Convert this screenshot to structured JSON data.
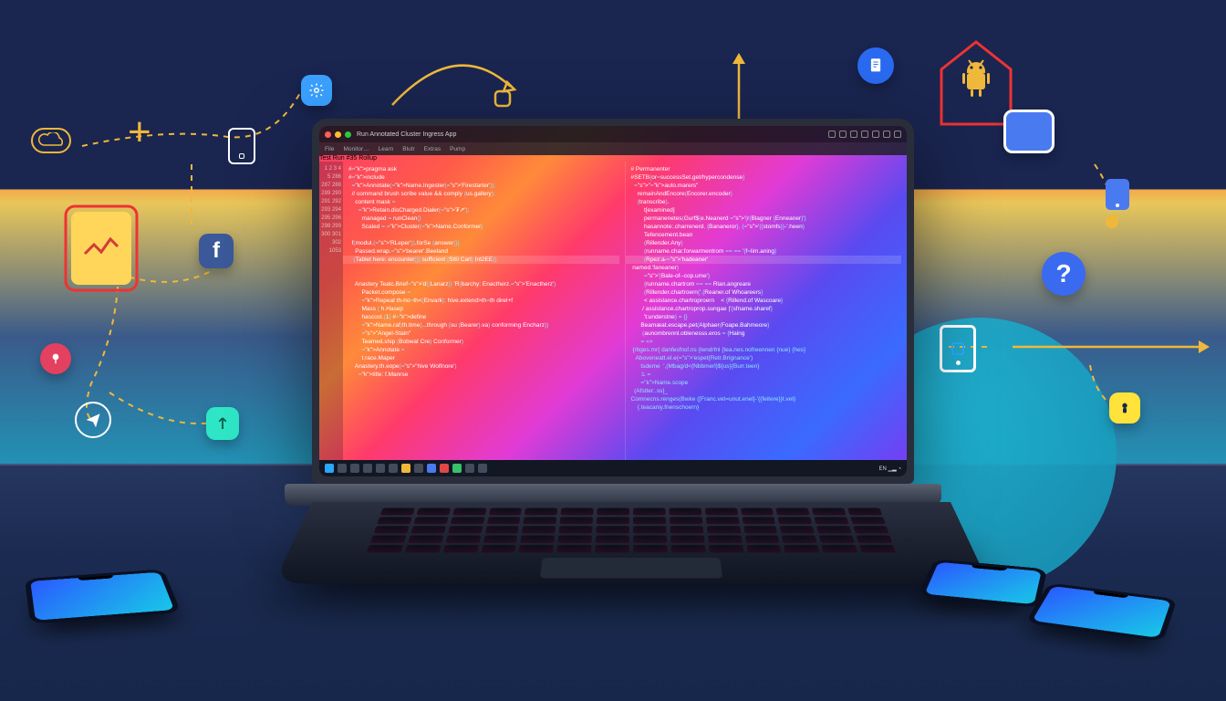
{
  "scene": {
    "description": "Stylized marketing illustration: an open laptop showing a colorful code editor on a desk, surrounded by three smartphones and floating app/platform icons connected with dotted lines.",
    "background_colors": [
      "#1a2550",
      "#f5a84a",
      "#1ba3c2",
      "#224070"
    ]
  },
  "laptop": {
    "window_title": "Run Annotated Cluster Ingress App",
    "menu": [
      "File",
      "Monitor…",
      "Learn",
      "Blutr",
      "Extras",
      "Pump"
    ],
    "tab_pill": "Test Run  #35 Rollup",
    "line_numbers": [
      "1",
      "2",
      "3",
      "4",
      "5",
      "286",
      "287",
      "288",
      "289",
      "290",
      "291",
      "292",
      "293",
      "294",
      "295",
      "296",
      "298",
      "299",
      "300",
      "301",
      "302",
      "1053"
    ],
    "code_left": [
      "#pragma ask",
      "#include <device>",
      "  Annotate(Name.Ingester('Firestarter'));",
      "  // command brush scribe value && comply (us.gallery);",
      "    content mask =",
      "      Retain.disCharged.Dialer('₮↗');",
      "        managed = runClean()",
      "        Scaled = Cluster(Name.Conformer)",
      "",
      "  f(modul.('RLeper')).forSe (answer())",
      "    Passed.wrap.'bearer'.Beeland",
      "   (Tablet here: encounter()) sufficient (Sttil Carl) Int2EE()",
      "",
      "    Anastery Teatc.Brief'd((Lanarz)) 'R{barchy: Enactherz.'Enactherz')",
      "        Packet.compose =",
      "        Repeat th-ho=th<{Envark}; hive.extend>th=th direl+f",
      "        Mass ( h.Hasep",
      "        hascost.(1) #define",
      "        Name.raf(th.time{...through {su (Bearer}.va) conforming Encharz))",
      "        \"Angel-Stain\"",
      "        Teamed.ship (Bobwat Cre) Conformer)",
      "        Annotate =",
      "        t,race.Maper",
      "    Anastery.th.eope(\"hive Wolfnore')",
      "      title: f.Manrse"
    ],
    "code_right": [
      "# Permanenter",
      "#SETB{or=successSet.get/hypercondense}",
      "  \"auto.marers\"",
      "    remainAndEncore(Encorer.encoder)",
      "    (transcribe).",
      "        t[examined]",
      "        permanenetes(Gurf${e.Neanerd '{r{Blagner {Enneaner}')",
      "        hasannote:.charrenerd, {Bananeror}, ('{{stomfs}}-'.heen)",
      "        Tefencement.bean",
      "        (Rillender.Any)",
      "        (runname.char.forwarmentrom == == '{f=lim.aning}",
      "        (Rpez:a-'hadeaner' named.'faneaner}",
      "        '{Bale-of--cop.ume'}",
      "        {runname.chartrom == == Rlan.angreare",
      "        (Rillender.chartroern{',{Reaner.of Whoareers}",
      "        < assistance.chartroproern    < {Rillend.of Wascoare}",
      "       / assistance.chartroprop.sungae |'{sfname.sharef}",
      "        't:understne) = {}",
      "      Beamæat.escape.pet(Alphaer(Foape.Bahmeore}",
      "       (aunombrennl.oblenesss.eros = {Haing",
      "      <rh humb.enuiruu = =>",
      " {rbges.mr{ danfesfnsf.ns {tendrfnl {tea.nes.nofreennen {nue) {hes}",
      "   Aboveneatt.el.e('espet{Retr.Brignance')",
      "      tsdeme  ',(Mbag/d<{Nbbmerl}${us}{Burr<a>.teen}",
      "      <Remoamerf>:L =",
      "      Name.scope",
      "  (Afstter:.ss}_",
      "Comnecns.renges(Bwke ([Franc.vet=unut.enel]-'{{feitere}}t.vet}",
      "    <arbenenenen{.teacaniy.fnenschoern}"
    ],
    "taskbar_clock": "EN  ▁▂  ◔"
  },
  "icons": {
    "cloud": "cloud-icon",
    "plus": "plus-icon",
    "doc_blue": "document-icon",
    "card_outline": "card-icon",
    "facebook": "facebook-icon",
    "chart_card": "analytics-icon",
    "pin": "push-pin-icon",
    "send": "paper-plane-icon",
    "mint_arrow": "transfer-icon",
    "gear": "settings-icon",
    "tablet_outline": "tablet-icon",
    "android": "android-icon",
    "tablet_blue": "tablet-filled-icon",
    "phone_outline": "phone-icon",
    "help": "help-icon",
    "tablet_blue2": "device-icon",
    "yellow_note": "note-icon"
  }
}
